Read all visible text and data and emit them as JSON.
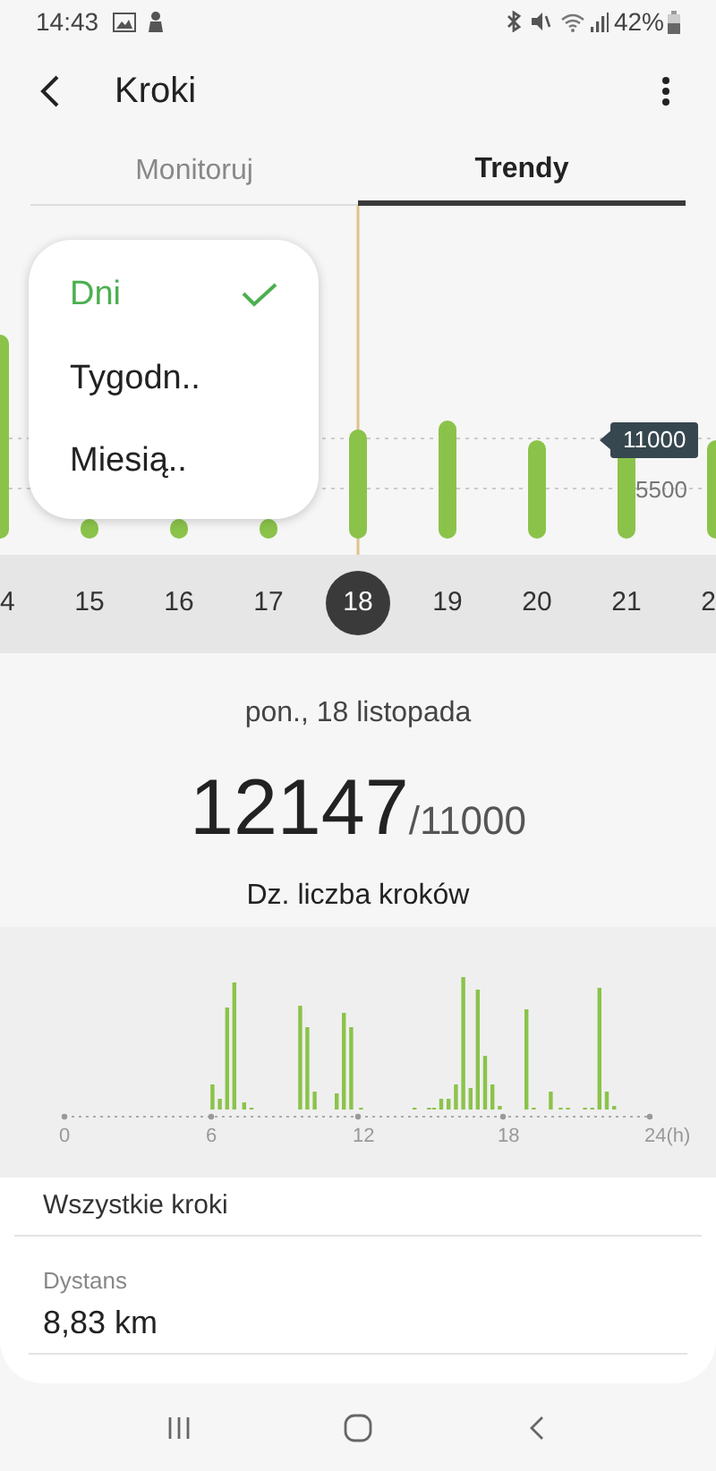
{
  "status_bar": {
    "time": "14:43",
    "battery": "42%"
  },
  "header": {
    "title": "Kroki"
  },
  "tabs": [
    {
      "label": "Monitoruj",
      "selected": false
    },
    {
      "label": "Trendy",
      "selected": true
    }
  ],
  "period_menu": [
    {
      "label": "Dni",
      "selected": true
    },
    {
      "label": "Tygodn..",
      "selected": false
    },
    {
      "label": "Miesią..",
      "selected": false
    }
  ],
  "daily_chart": {
    "goal_label": "11000",
    "mid_label": "5500"
  },
  "days": [
    {
      "label": "4",
      "selected": false
    },
    {
      "label": "15",
      "selected": false
    },
    {
      "label": "16",
      "selected": false
    },
    {
      "label": "17",
      "selected": false
    },
    {
      "label": "18",
      "selected": true
    },
    {
      "label": "19",
      "selected": false
    },
    {
      "label": "20",
      "selected": false
    },
    {
      "label": "21",
      "selected": false
    },
    {
      "label": "2",
      "selected": false
    }
  ],
  "summary": {
    "date": "pon., 18 listopada",
    "steps": "12147",
    "goal": "/11000",
    "caption": "Dz. liczba kroków"
  },
  "hourly_chart": {
    "x_labels": [
      "0",
      "6",
      "12",
      "18",
      "24(h)"
    ]
  },
  "details": {
    "heading": "Wszystkie kroki",
    "label": "Dystans",
    "value": "8,83 km"
  }
}
